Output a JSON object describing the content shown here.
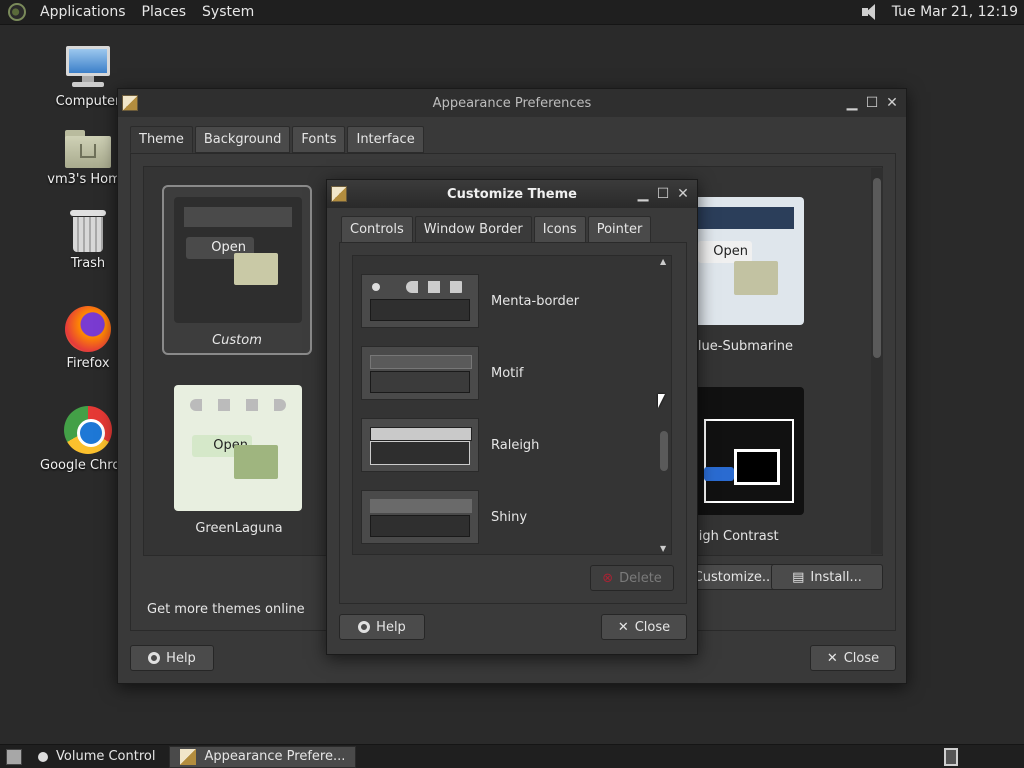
{
  "top_panel": {
    "menus": [
      "Applications",
      "Places",
      "System"
    ],
    "clock": "Tue Mar 21, 12:19",
    "icons": [
      "gnome-foot-icon",
      "volume-icon"
    ]
  },
  "desktop": {
    "icons": [
      {
        "label": "Computer",
        "icon": "computer-icon"
      },
      {
        "label": "vm3's Home",
        "icon": "home-folder-icon"
      },
      {
        "label": "Trash",
        "icon": "trash-icon"
      },
      {
        "label": "Firefox",
        "icon": "firefox-icon"
      },
      {
        "label": "Google Chrome",
        "icon": "chrome-icon"
      }
    ]
  },
  "appearance": {
    "title": "Appearance Preferences",
    "tabs": [
      "Theme",
      "Background",
      "Fonts",
      "Interface"
    ],
    "active_tab": "Theme",
    "themes": [
      {
        "name": "Custom"
      },
      {
        "name": "GreenLaguna"
      },
      {
        "name": "Blue-Submarine"
      },
      {
        "name": "High Contrast"
      }
    ],
    "preview_text": {
      "open": "Open"
    },
    "get_more": "Get more themes online",
    "customize_label": "Customize...",
    "install_label": "Install...",
    "help_label": "Help",
    "close_label": "Close"
  },
  "customize": {
    "title": "Customize Theme",
    "tabs": [
      "Controls",
      "Window Border",
      "Icons",
      "Pointer"
    ],
    "active_tab": "Window Border",
    "items": [
      "Menta-border",
      "Motif",
      "Raleigh",
      "Shiny"
    ],
    "delete_label": "Delete",
    "help_label": "Help",
    "close_label": "Close"
  },
  "taskbar": {
    "tasks": [
      "Volume Control",
      "Appearance Prefere..."
    ]
  },
  "colors": {
    "panel": "#1f1f1f",
    "window": "#393939",
    "desktop": "#2a2a2a",
    "text": "#e6e6e6"
  }
}
